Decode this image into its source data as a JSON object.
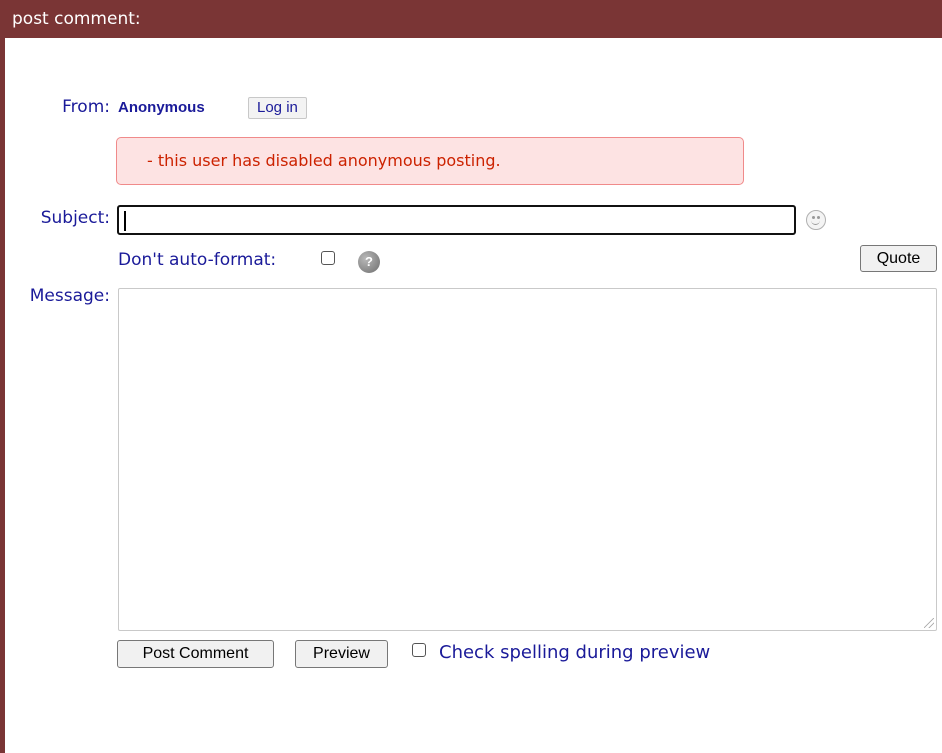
{
  "header": {
    "title": "post comment:"
  },
  "form": {
    "from_label": "From:",
    "from_user": "Anonymous",
    "login_label": "Log in",
    "alert_text": "- this user has disabled anonymous posting.",
    "subject_label": "Subject:",
    "subject_value": "",
    "autoformat_label": "Don't auto-format:",
    "autoformat_checked": false,
    "help_glyph": "?",
    "quote_label": "Quote",
    "message_label": "Message:",
    "message_value": "",
    "post_label": "Post Comment",
    "preview_label": "Preview",
    "spellcheck_label": "Check spelling during preview",
    "spellcheck_checked": false
  },
  "icons": {
    "smiley": "smiley-icon",
    "help": "help-icon"
  },
  "colors": {
    "header_bg": "#7a3535",
    "label": "#1a1a99",
    "alert_bg": "#fde3e3",
    "alert_border": "#f08a8a",
    "alert_text": "#cc2200"
  }
}
